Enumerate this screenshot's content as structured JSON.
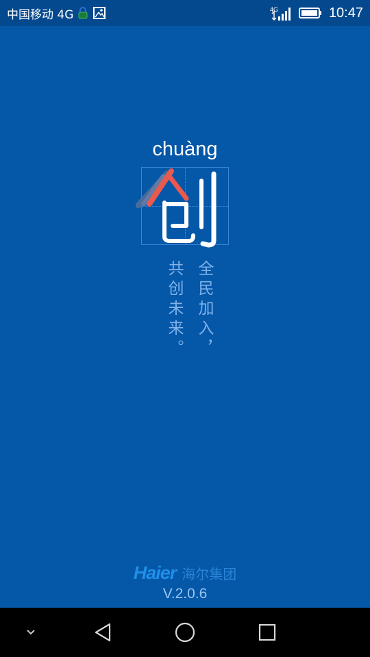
{
  "status_bar": {
    "carrier": "中国移动 4G",
    "time": "10:47",
    "network_badge": "4G",
    "icons": [
      "lock-icon",
      "image-icon",
      "signal-icon",
      "battery-icon"
    ]
  },
  "splash": {
    "pinyin": "chuàng",
    "character": "创",
    "slogan_columns": [
      "全民加入，",
      "共创未来。"
    ]
  },
  "brand": {
    "logo_text": "Haier",
    "group_name": "海尔集团",
    "version": "V.2.0.6"
  },
  "nav_bar": {
    "buttons": [
      "hide-keyboard-icon",
      "back-icon",
      "home-icon",
      "recent-apps-icon"
    ]
  },
  "colors": {
    "background": "#0557a8",
    "status_bar": "#04498e",
    "stroke_highlight": "#e85a4f",
    "slogan": "#7fb3ea"
  }
}
